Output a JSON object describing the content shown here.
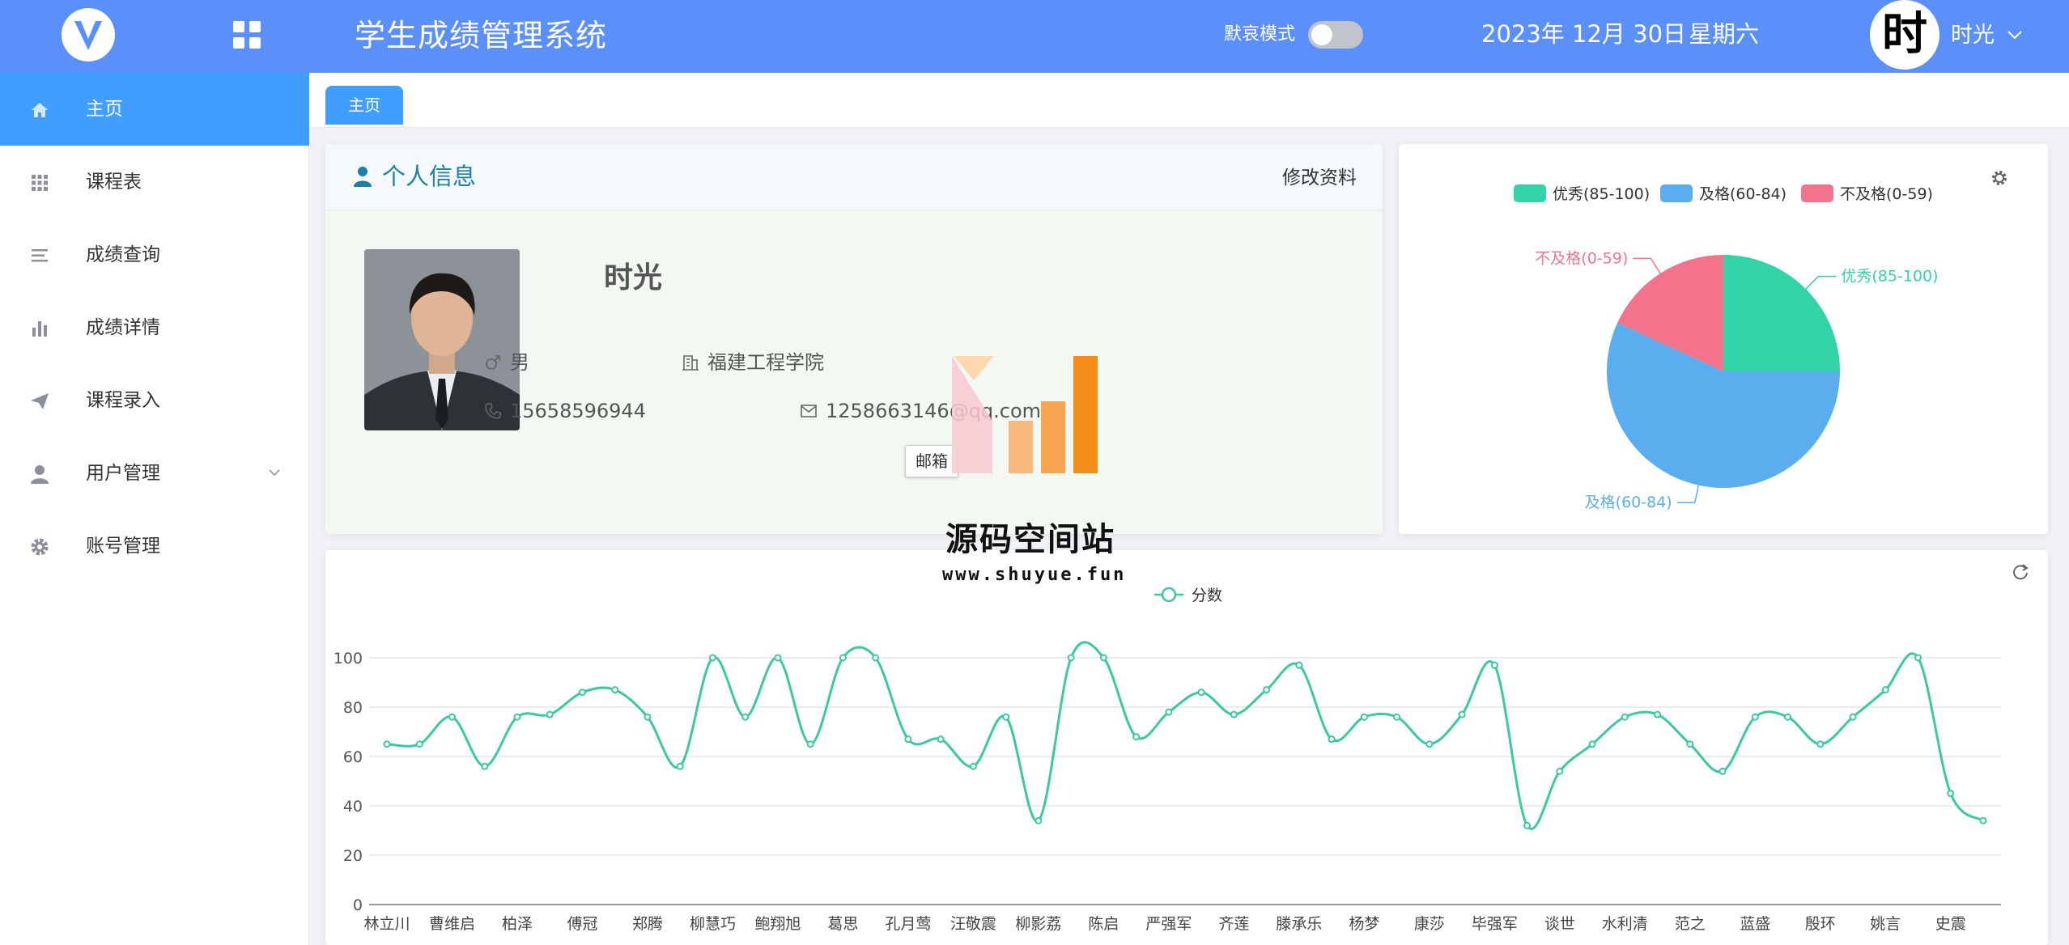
{
  "header": {
    "title": "学生成绩管理系统",
    "mourn_mode_label": "默哀模式",
    "date": "2023年 12月 30日",
    "weekday": "星期六",
    "avatar_char": "时",
    "user_name": "时光"
  },
  "sidebar": {
    "items": [
      {
        "label": "主页",
        "icon": "home-icon",
        "active": true
      },
      {
        "label": "课程表",
        "icon": "grid-icon"
      },
      {
        "label": "成绩查询",
        "icon": "list-icon"
      },
      {
        "label": "成绩详情",
        "icon": "bar-chart-icon"
      },
      {
        "label": "课程录入",
        "icon": "send-icon"
      },
      {
        "label": "用户管理",
        "icon": "user-icon",
        "has_submenu": true
      },
      {
        "label": "账号管理",
        "icon": "gear-icon"
      }
    ]
  },
  "tabs": [
    {
      "label": "主页"
    }
  ],
  "profile": {
    "section_title": "个人信息",
    "edit_label": "修改资料",
    "name": "时光",
    "gender": "男",
    "school": "福建工程学院",
    "phone": "15658596944",
    "email": "1258663146@qq.com",
    "tooltip": "邮箱"
  },
  "watermark": {
    "text": "源码空间站",
    "url": "www.shuyue.fun"
  },
  "colors": {
    "header": "#5b8ff9",
    "active_menu": "#409eff",
    "excellent": "#32d3a6",
    "pass": "#5aaeee",
    "fail": "#f4738c",
    "line": "#3ac9a0"
  },
  "chart_data": [
    {
      "type": "pie",
      "legend": [
        "优秀(85-100)",
        "及格(60-84)",
        "不及格(0-59)"
      ],
      "legend_position": "top",
      "slices": [
        {
          "name": "优秀(85-100)",
          "value": 11
        },
        {
          "name": "及格(60-84)",
          "value": 25
        },
        {
          "name": "不及格(0-59)",
          "value": 8
        }
      ]
    },
    {
      "type": "line",
      "series_name": "分数",
      "legend_position": "top",
      "ylim": [
        0,
        100
      ],
      "yticks": [
        0,
        20,
        40,
        60,
        80,
        100
      ],
      "grid": true,
      "smooth": true,
      "category_labels": [
        "林立川",
        "曹维启",
        "柏泽",
        "傅冠",
        "郑腾",
        "柳慧巧",
        "鲍翔旭",
        "葛思",
        "孔月莺",
        "汪敬震",
        "柳影荔",
        "陈启",
        "严强军",
        "齐莲",
        "滕承乐",
        "杨梦",
        "康莎",
        "毕强军",
        "谈世",
        "水利清",
        "范之",
        "蓝盛",
        "殷环",
        "姚言",
        "史震"
      ],
      "values": [
        65,
        65,
        76,
        56,
        76,
        77,
        86,
        87,
        76,
        56,
        100,
        76,
        100,
        65,
        100,
        100,
        67,
        67,
        56,
        76,
        34,
        100,
        100,
        68,
        78,
        86,
        77,
        87,
        97,
        67,
        76,
        76,
        65,
        77,
        97,
        32,
        54,
        65,
        76,
        77,
        65,
        54,
        76,
        76,
        65,
        76,
        87,
        100,
        45,
        34
      ]
    }
  ]
}
